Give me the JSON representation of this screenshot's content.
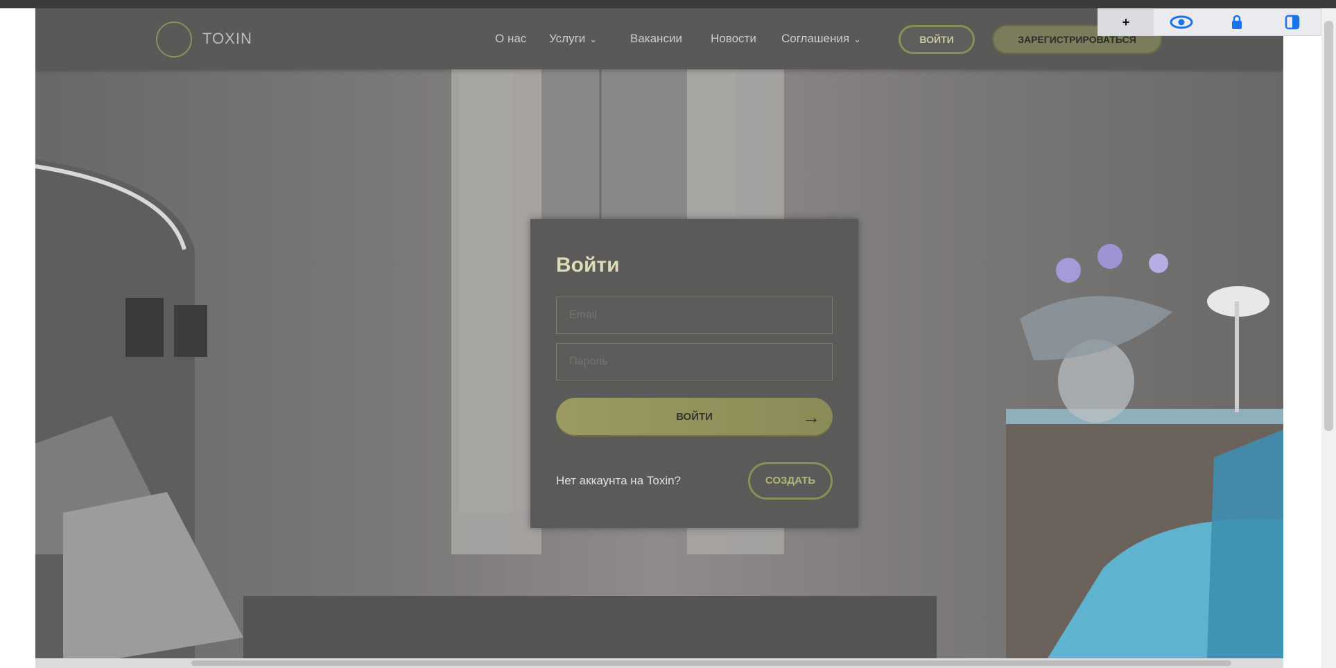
{
  "header": {
    "logo_text": "TOXIN",
    "nav": [
      {
        "label": "О нас"
      },
      {
        "label": "Услуги"
      },
      {
        "label": "Вакансии"
      },
      {
        "label": "Новости"
      },
      {
        "label": "Соглашения"
      }
    ],
    "login_label": "ВОЙТИ",
    "register_label": "ЗАРЕГИСТРИРОВАТЬСЯ"
  },
  "extension_toolbar": {
    "icons": [
      "plus-icon",
      "eye-icon",
      "lock-icon",
      "contrast-icon"
    ],
    "plus_glyph": "+"
  },
  "login_card": {
    "title": "Войти",
    "email_placeholder": "Email",
    "password_placeholder": "Пароль",
    "submit_label": "ВОЙТИ",
    "no_account_text": "Нет аккаунта на Toxin?",
    "create_label": "СОЗДАТЬ"
  },
  "colors": {
    "header_bg": "#595958",
    "accent": "#8b8e55",
    "card_bg": "#5a5a59"
  }
}
